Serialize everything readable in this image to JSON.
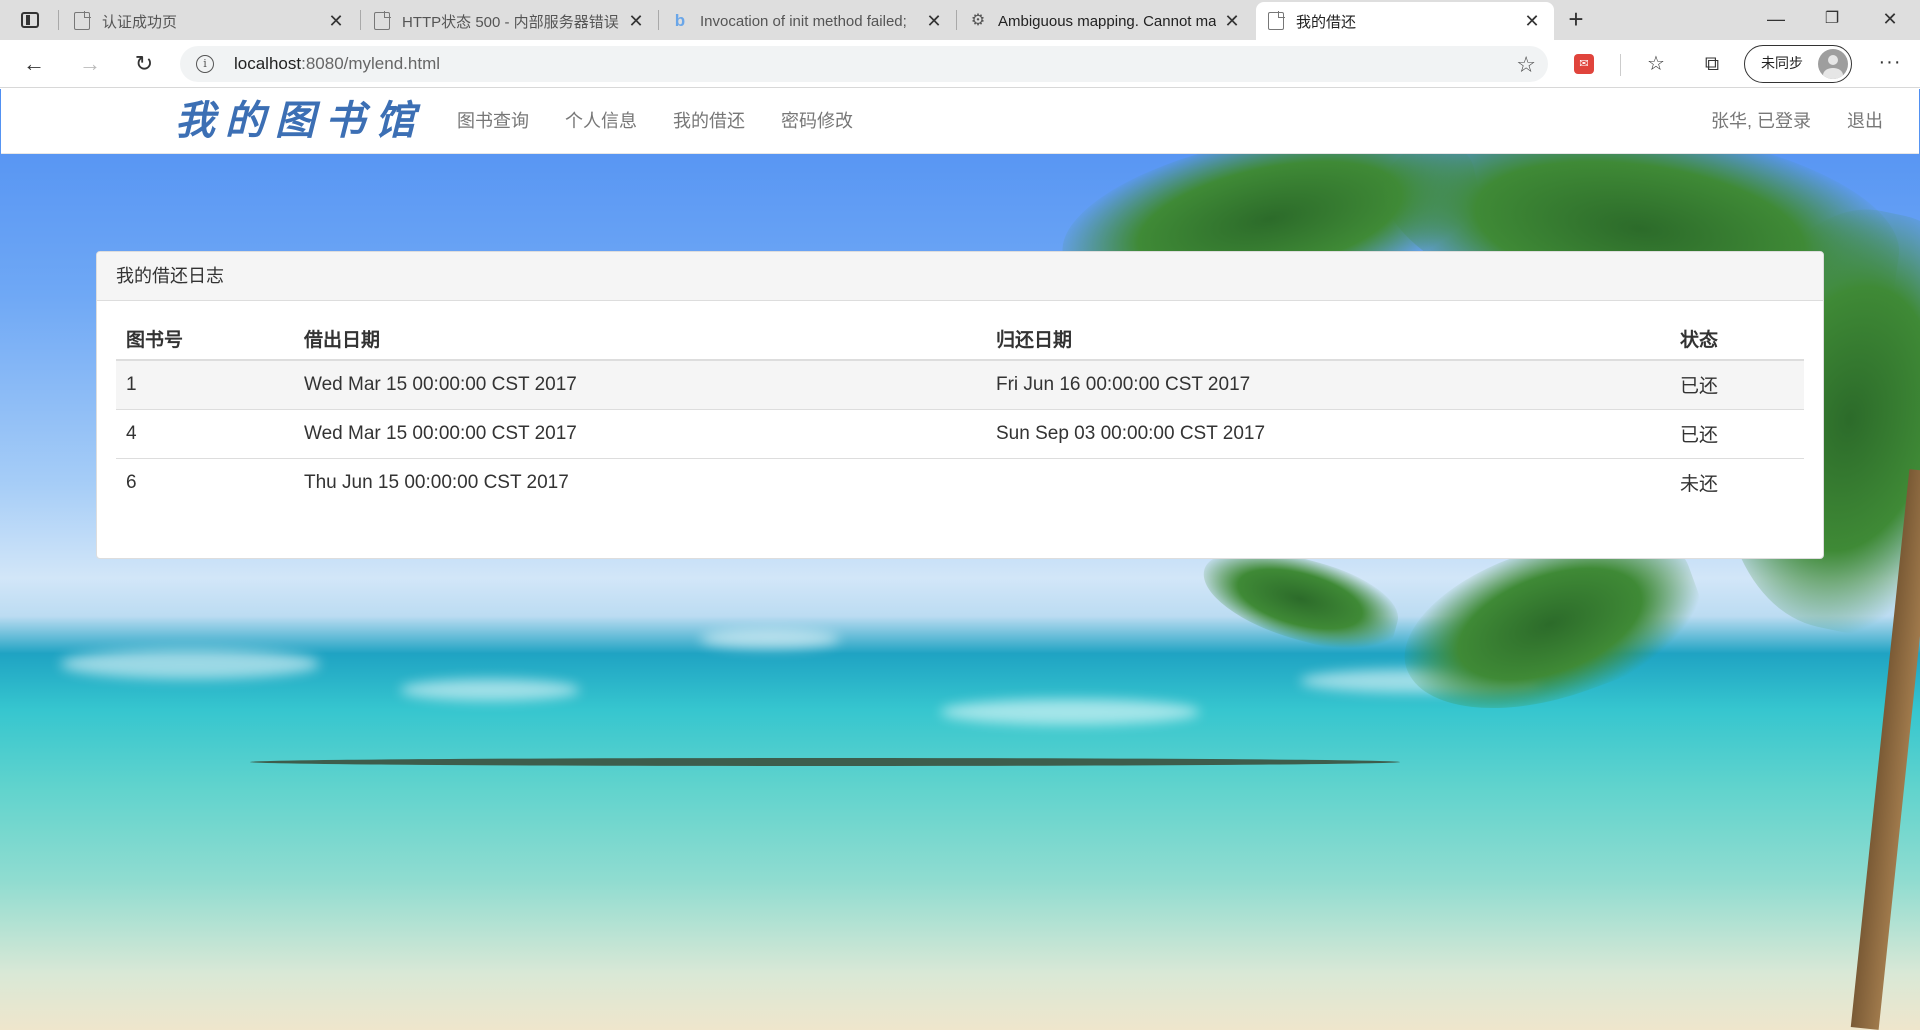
{
  "browser": {
    "tabs": [
      {
        "title": "认证成功页",
        "icon": "page-icon"
      },
      {
        "title": "HTTP状态 500 - 内部服务器错误",
        "icon": "page-icon"
      },
      {
        "title": "Invocation of init method failed;",
        "icon": "bing-icon"
      },
      {
        "title": "Ambiguous mapping. Cannot map",
        "icon": "gear-icon"
      },
      {
        "title": "我的借还",
        "icon": "page-icon",
        "active": true
      }
    ],
    "url_host": "localhost",
    "url_rest": ":8080/mylend.html",
    "sync_label": "未同步"
  },
  "navbar": {
    "brand": "我的图书馆",
    "links": [
      "图书查询",
      "个人信息",
      "我的借还",
      "密码修改"
    ],
    "user_status": "张华, 已登录",
    "logout": "退出"
  },
  "panel": {
    "title": "我的借还日志",
    "columns": [
      "图书号",
      "借出日期",
      "归还日期",
      "状态"
    ],
    "rows": [
      {
        "book_id": "1",
        "lend_date": "Wed Mar 15 00:00:00 CST 2017",
        "back_date": "Fri Jun 16 00:00:00 CST 2017",
        "status": "已还"
      },
      {
        "book_id": "4",
        "lend_date": "Wed Mar 15 00:00:00 CST 2017",
        "back_date": "Sun Sep 03 00:00:00 CST 2017",
        "status": "已还"
      },
      {
        "book_id": "6",
        "lend_date": "Thu Jun 15 00:00:00 CST 2017",
        "back_date": "",
        "status": "未还"
      }
    ]
  },
  "colors": {
    "brand": "#3c6fb4",
    "nav_text": "#777777",
    "panel_heading_bg": "#f5f5f5"
  }
}
